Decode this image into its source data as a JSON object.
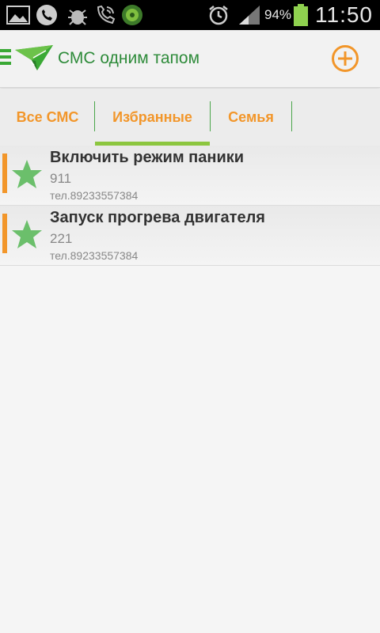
{
  "status_bar": {
    "icons": [
      "gallery-icon",
      "missed-call-icon",
      "usb-debug-icon",
      "phone-call-icon",
      "app-shield-icon",
      "alarm-icon",
      "signal-icon",
      "battery-icon"
    ],
    "battery_percent": "94%",
    "time": "11:50"
  },
  "header": {
    "title": "СМС одним тапом",
    "accent_color": "#3aa935",
    "add_icon": "plus-circle-icon",
    "add_color": "#f2962a"
  },
  "tabs": [
    {
      "label": "Все СМС",
      "selected": false
    },
    {
      "label": "Избранные",
      "selected": true
    },
    {
      "label": "Семья",
      "selected": false
    }
  ],
  "items": [
    {
      "title": "Включить режим паники",
      "code": "911",
      "phone": "тел.89233557384",
      "icon": "star-icon"
    },
    {
      "title": "Запуск прогрева двигателя",
      "code": "221",
      "phone": "тел.89233557384",
      "icon": "star-icon"
    }
  ]
}
